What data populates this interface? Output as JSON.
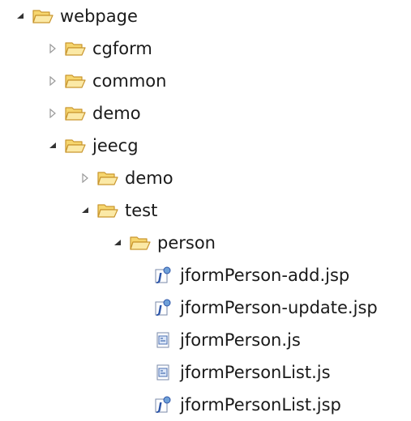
{
  "tree": {
    "items": [
      {
        "label": "webpage",
        "type": "folder",
        "state": "expanded",
        "depth": 0
      },
      {
        "label": "cgform",
        "type": "folder",
        "state": "collapsed",
        "depth": 1
      },
      {
        "label": "common",
        "type": "folder",
        "state": "collapsed",
        "depth": 1
      },
      {
        "label": "demo",
        "type": "folder",
        "state": "collapsed",
        "depth": 1
      },
      {
        "label": "jeecg",
        "type": "folder",
        "state": "expanded",
        "depth": 1
      },
      {
        "label": "demo",
        "type": "folder",
        "state": "collapsed",
        "depth": 2
      },
      {
        "label": "test",
        "type": "folder",
        "state": "expanded",
        "depth": 2
      },
      {
        "label": "person",
        "type": "folder",
        "state": "expanded",
        "depth": 3
      },
      {
        "label": "jformPerson-add.jsp",
        "type": "jsp-file",
        "depth": 4
      },
      {
        "label": "jformPerson-update.jsp",
        "type": "jsp-file",
        "depth": 4
      },
      {
        "label": "jformPerson.js",
        "type": "js-file",
        "depth": 4
      },
      {
        "label": "jformPersonList.js",
        "type": "js-file",
        "depth": 4
      },
      {
        "label": "jformPersonList.jsp",
        "type": "jsp-file",
        "depth": 4
      }
    ]
  },
  "icons": {
    "folder": "folder-open-icon",
    "jsp-file": "jsp-file-icon",
    "js-file": "js-file-icon",
    "expanded": "expanded-arrow-icon",
    "collapsed": "collapsed-arrow-icon"
  },
  "colors": {
    "folder_fill": "#f6d66f",
    "folder_stroke": "#c9962f",
    "arrow_dark": "#333333",
    "arrow_light": "#9a9a9a",
    "jsp_blue": "#2d55a8",
    "js_blue": "#4a6fb3"
  }
}
